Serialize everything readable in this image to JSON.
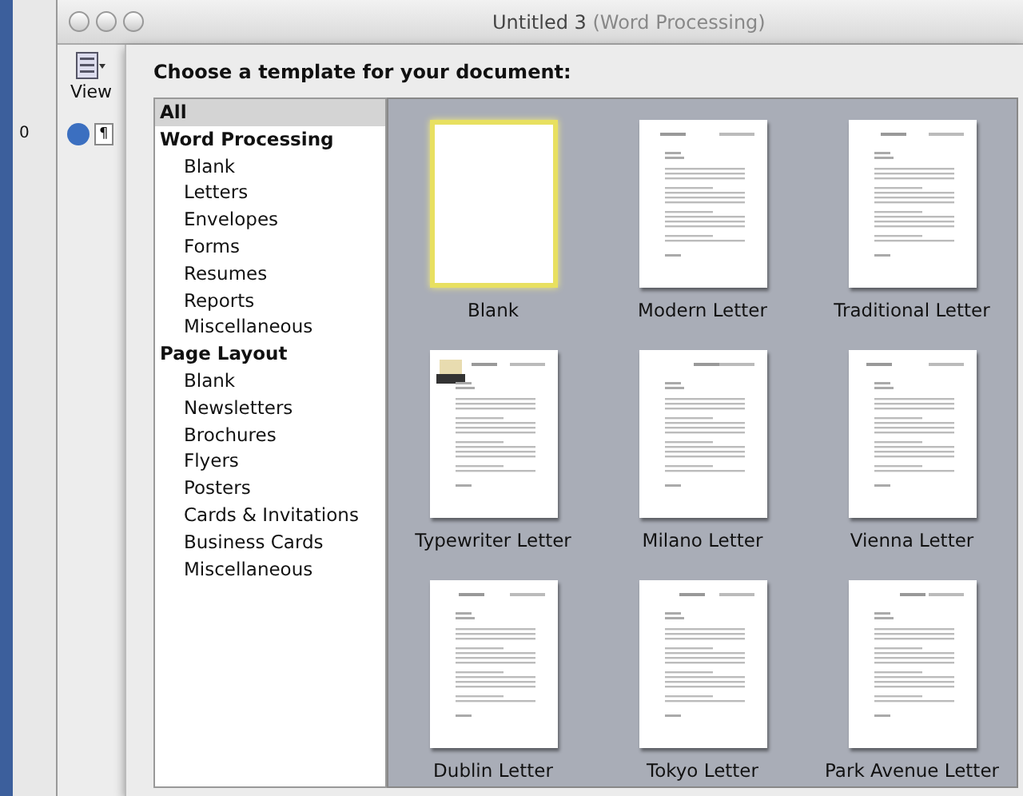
{
  "back_window": {
    "ruler_mark": "0"
  },
  "window": {
    "title": "Untitled 3",
    "subtitle": "(Word Processing)"
  },
  "toolbar": {
    "view_button": "View",
    "paragraph_button": "¶"
  },
  "sheet": {
    "heading": "Choose a template for your document:",
    "categories": [
      {
        "label": "All",
        "selected": true
      },
      {
        "label": "Word Processing",
        "selected": false,
        "children": [
          {
            "label": "Blank",
            "selected": false
          },
          {
            "label": "Letters",
            "selected": false
          },
          {
            "label": "Envelopes",
            "selected": false
          },
          {
            "label": "Forms",
            "selected": false
          },
          {
            "label": "Resumes",
            "selected": false
          },
          {
            "label": "Reports",
            "selected": false
          },
          {
            "label": "Miscellaneous",
            "selected": false
          }
        ]
      },
      {
        "label": "Page Layout",
        "selected": false,
        "children": [
          {
            "label": "Blank",
            "selected": false
          },
          {
            "label": "Newsletters",
            "selected": false
          },
          {
            "label": "Brochures",
            "selected": false
          },
          {
            "label": "Flyers",
            "selected": false
          },
          {
            "label": "Posters",
            "selected": false
          },
          {
            "label": "Cards & Invitations",
            "selected": false
          },
          {
            "label": "Business Cards",
            "selected": false
          },
          {
            "label": "Miscellaneous",
            "selected": false
          }
        ]
      }
    ],
    "templates": [
      {
        "name": "Blank",
        "kind": "blank",
        "selected": true
      },
      {
        "name": "Modern Letter",
        "kind": "letter",
        "selected": false
      },
      {
        "name": "Traditional Letter",
        "kind": "letter",
        "selected": false
      },
      {
        "name": "Typewriter Letter",
        "kind": "typewriter",
        "selected": false
      },
      {
        "name": "Milano Letter",
        "kind": "letter",
        "selected": false
      },
      {
        "name": "Vienna Letter",
        "kind": "letter",
        "selected": false
      },
      {
        "name": "Dublin Letter",
        "kind": "letter",
        "selected": false
      },
      {
        "name": "Tokyo Letter",
        "kind": "letter",
        "selected": false
      },
      {
        "name": "Park Avenue Letter",
        "kind": "letter",
        "selected": false
      }
    ]
  }
}
